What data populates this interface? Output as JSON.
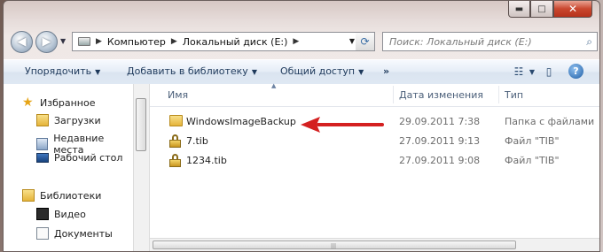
{
  "caption": {
    "minimize": "▬",
    "maximize": "□",
    "close": "✕"
  },
  "address": {
    "parts": [
      "Компьютер",
      "Локальный диск (E:)"
    ]
  },
  "search": {
    "placeholder": "Поиск: Локальный диск (E:)"
  },
  "toolbar": {
    "organize": "Упорядочить",
    "add_to_library": "Добавить в библиотеку",
    "share": "Общий доступ",
    "more": "»"
  },
  "nav": {
    "favorites": "Избранное",
    "downloads": "Загрузки",
    "recent": "Недавние места",
    "desktop": "Рабочий стол",
    "libraries": "Библиотеки",
    "video": "Видео",
    "documents": "Документы"
  },
  "columns": {
    "name": "Имя",
    "date": "Дата изменения",
    "type": "Тип"
  },
  "files": [
    {
      "name": "WindowsImageBackup",
      "date": "29.09.2011 7:38",
      "type": "Папка с файлами",
      "icon": "folder-icon"
    },
    {
      "name": "7.tib",
      "date": "27.09.2011 9:13",
      "type": "Файл \"TIB\"",
      "icon": "lock-icon"
    },
    {
      "name": "1234.tib",
      "date": "27.09.2011 9:08",
      "type": "Файл \"TIB\"",
      "icon": "lock-icon"
    }
  ],
  "colors": {
    "annotation_arrow": "#d42020",
    "toolbar_text": "#1e395b"
  }
}
